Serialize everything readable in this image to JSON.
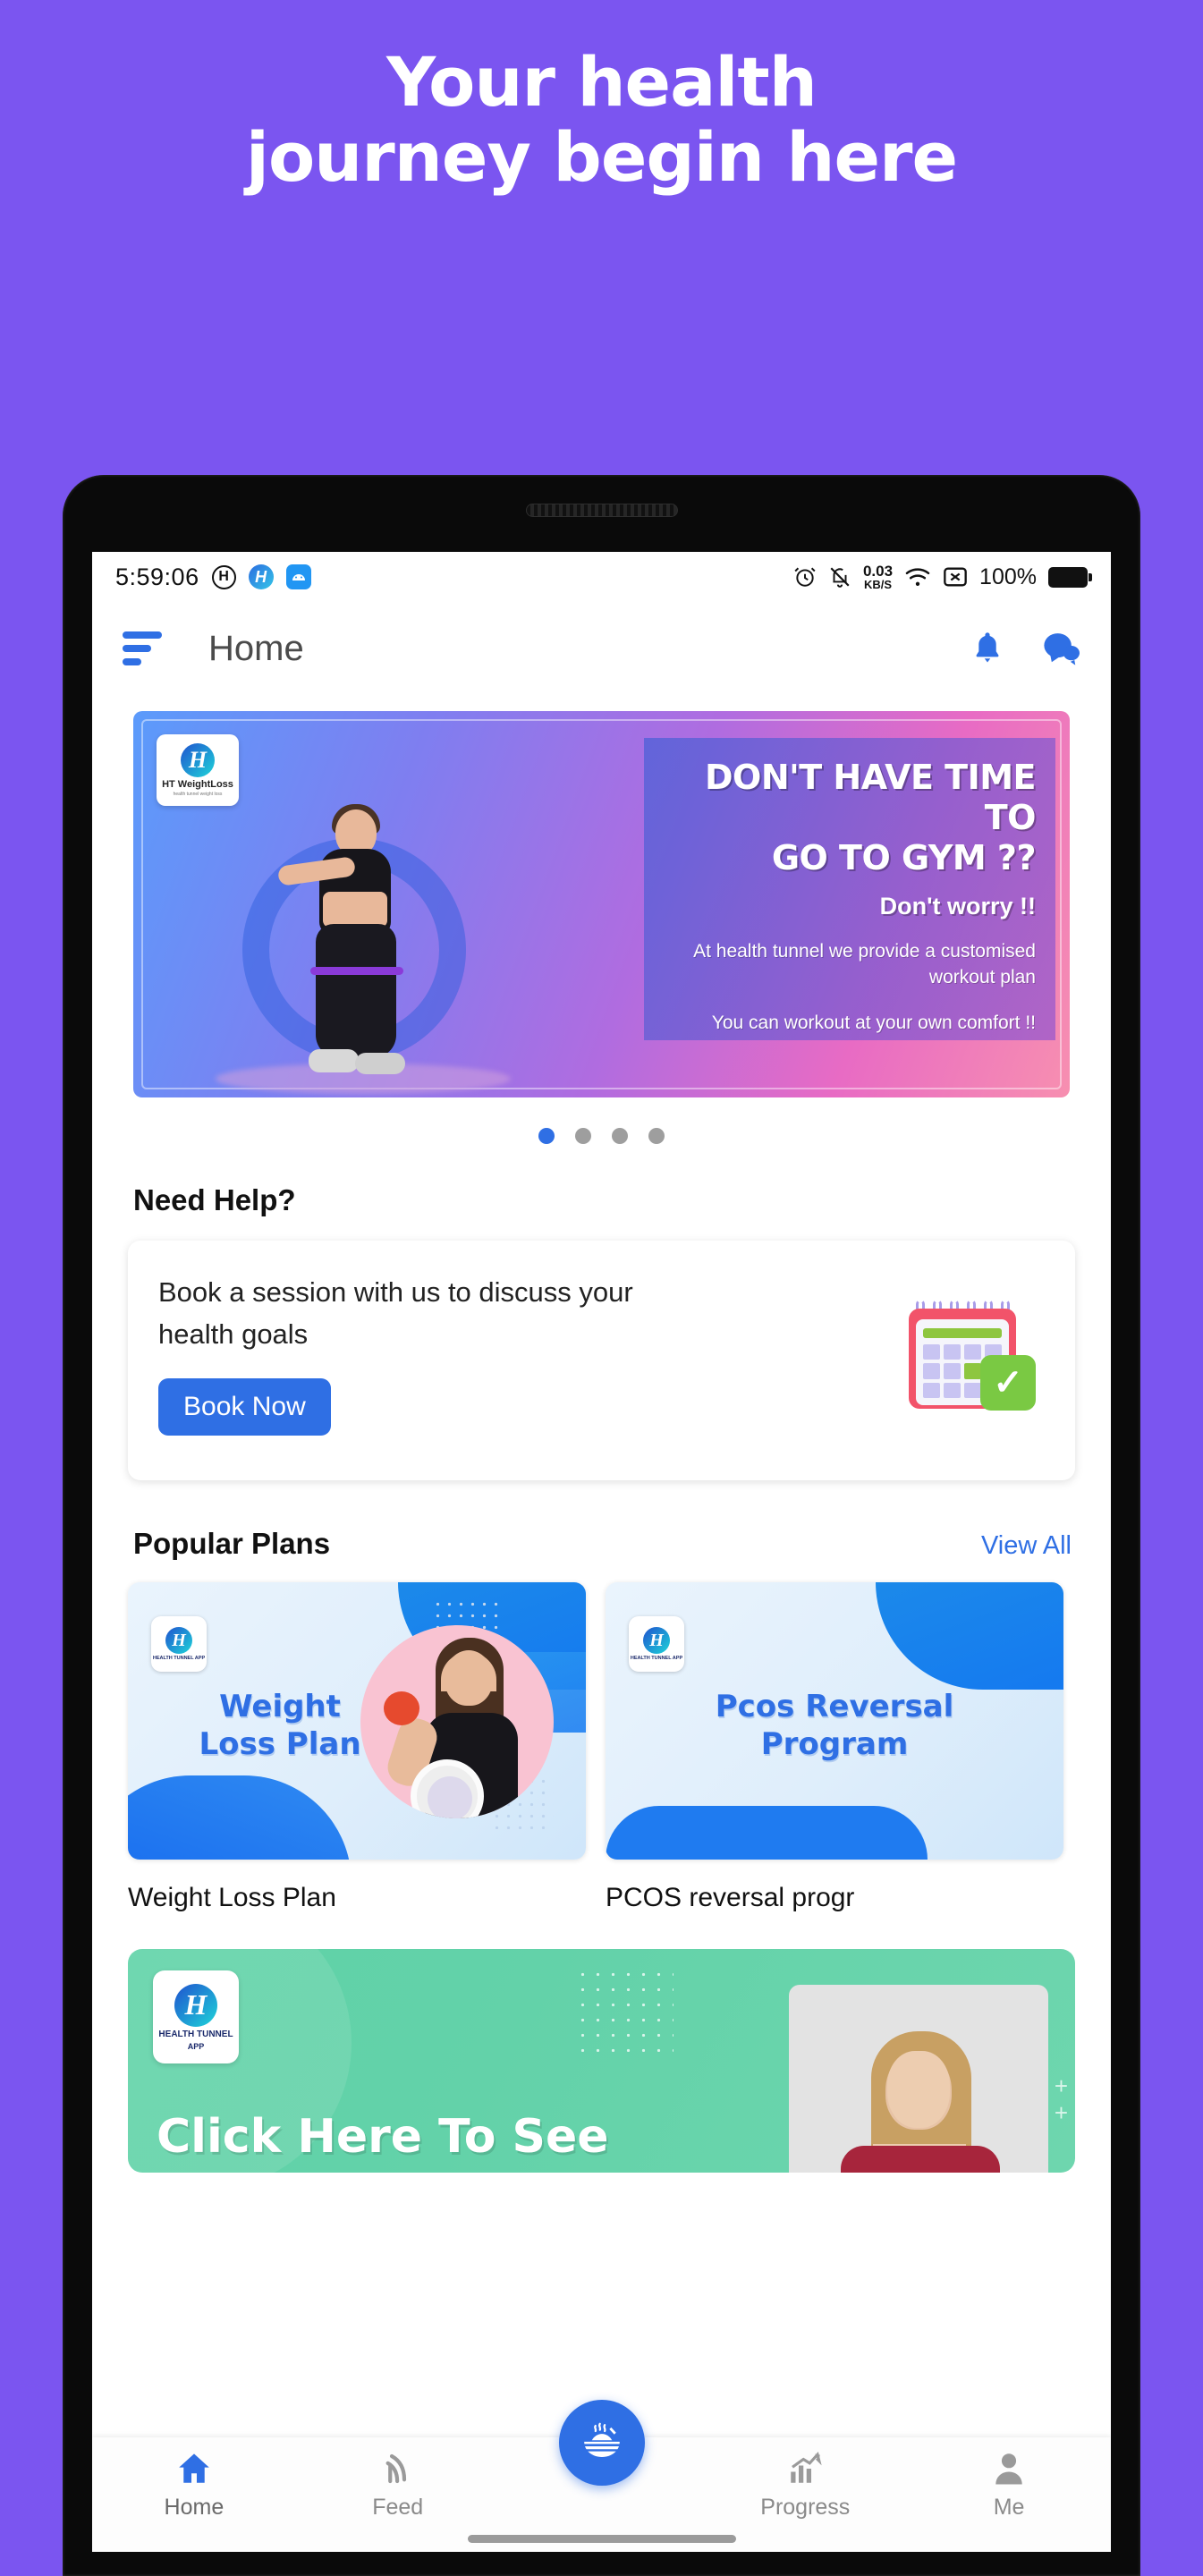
{
  "promo": {
    "line1": "Your health",
    "line2": "journey begin here",
    "background_color": "#7B55F0",
    "text_color": "#FFFFFF"
  },
  "status_bar": {
    "time": "5:59:06",
    "icons_left": [
      "hexa-circle-icon",
      "health-tunnel-icon",
      "android-blue-icon"
    ],
    "alarm_icon": "alarm-icon",
    "notification_off_icon": "bell-off-icon",
    "net_speed_value": "0.03",
    "net_speed_unit": "KB/S",
    "wifi_icon": "wifi-icon",
    "sim_icon": "sim-no-signal-icon",
    "battery_percent": "100%",
    "battery_icon": "battery-full-icon"
  },
  "app_bar": {
    "menu_icon": "hamburger-menu-icon",
    "title": "Home",
    "notification_icon": "bell-icon",
    "chat_icon": "chat-bubble-icon"
  },
  "banner": {
    "logo_text": "HT WeightLoss",
    "logo_sub": "health tunnel weight loss",
    "headline_line1": "DON'T HAVE TIME TO",
    "headline_line2": "GO TO GYM ??",
    "subhead": "Don't worry !!",
    "body_line1": "At health tunnel we provide a customised",
    "body_line2": "workout plan",
    "body_line3": "You can workout at your own comfort !!"
  },
  "carousel": {
    "total_dots": 4,
    "active_index": 0,
    "active_color": "#2F6FE4",
    "inactive_color": "#9E9E9E"
  },
  "need_help": {
    "title": "Need Help?",
    "body_line1": "Book a session with us to discuss your",
    "body_line2": "health goals",
    "button_label": "Book Now",
    "button_color": "#2F6FE4",
    "illustration": "calendar-check-icon"
  },
  "popular_plans": {
    "title": "Popular Plans",
    "view_all_label": "View All",
    "view_all_color": "#2F6FE4",
    "cards": [
      {
        "logo_text": "HEALTH TUNNEL APP",
        "title_line1": "Weight",
        "title_line2": "Loss Plan",
        "caption": "Weight Loss Plan"
      },
      {
        "logo_text": "HEALTH TUNNEL APP",
        "title_line1": "Pcos Reversal",
        "title_line2": "Program",
        "caption": "PCOS reversal progr"
      }
    ]
  },
  "green_banner": {
    "logo_text": "HEALTH TUNNEL",
    "logo_sub": "APP",
    "headline": "Click Here To See",
    "background_color": "#63D2A9"
  },
  "bottom_nav": {
    "items": [
      {
        "label": "Home",
        "icon": "home-icon",
        "active": true
      },
      {
        "label": "Feed",
        "icon": "feed-rss-icon",
        "active": false
      },
      {
        "label": "Progress",
        "icon": "progress-chart-icon",
        "active": false
      },
      {
        "label": "Me",
        "icon": "person-icon",
        "active": false
      }
    ],
    "fab_icon": "meal-bowl-icon",
    "fab_color": "#2F6FE4",
    "active_color": "#2F6FE4"
  }
}
